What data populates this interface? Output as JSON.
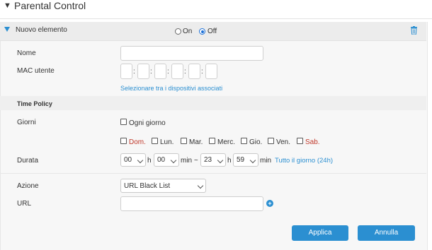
{
  "section": {
    "title": "Parental Control"
  },
  "item": {
    "label": "Nuovo elemento",
    "on_label": "On",
    "off_label": "Off",
    "selected": "Off"
  },
  "form": {
    "nome_label": "Nome",
    "nome_value": "",
    "mac_label": "MAC utente",
    "mac_values": [
      "",
      "",
      "",
      "",
      "",
      ""
    ],
    "select_devices_link": "Selezionare tra i dispositivi associati"
  },
  "time_policy": {
    "heading": "Time Policy",
    "giorni_label": "Giorni",
    "ogni_giorno": "Ogni giorno",
    "days": [
      {
        "label": "Dom.",
        "weekend": true
      },
      {
        "label": "Lun.",
        "weekend": false
      },
      {
        "label": "Mar.",
        "weekend": false
      },
      {
        "label": "Merc.",
        "weekend": false
      },
      {
        "label": "Gio.",
        "weekend": false
      },
      {
        "label": "Ven.",
        "weekend": false
      },
      {
        "label": "Sab.",
        "weekend": true
      }
    ],
    "durata_label": "Durata",
    "start_hour": "00",
    "h1": "h",
    "start_min": "00",
    "min_tilde": "min ~",
    "end_hour": "23",
    "h2": "h",
    "end_min": "59",
    "min2": "min",
    "all_day_link": "Tutto il giorno (24h)"
  },
  "action": {
    "azione_label": "Azione",
    "azione_value": "URL Black List",
    "url_label": "URL",
    "url_value": ""
  },
  "buttons": {
    "apply": "Applica",
    "cancel": "Annulla"
  },
  "colors": {
    "accent": "#2b8fd1",
    "weekend": "#c0392b"
  }
}
